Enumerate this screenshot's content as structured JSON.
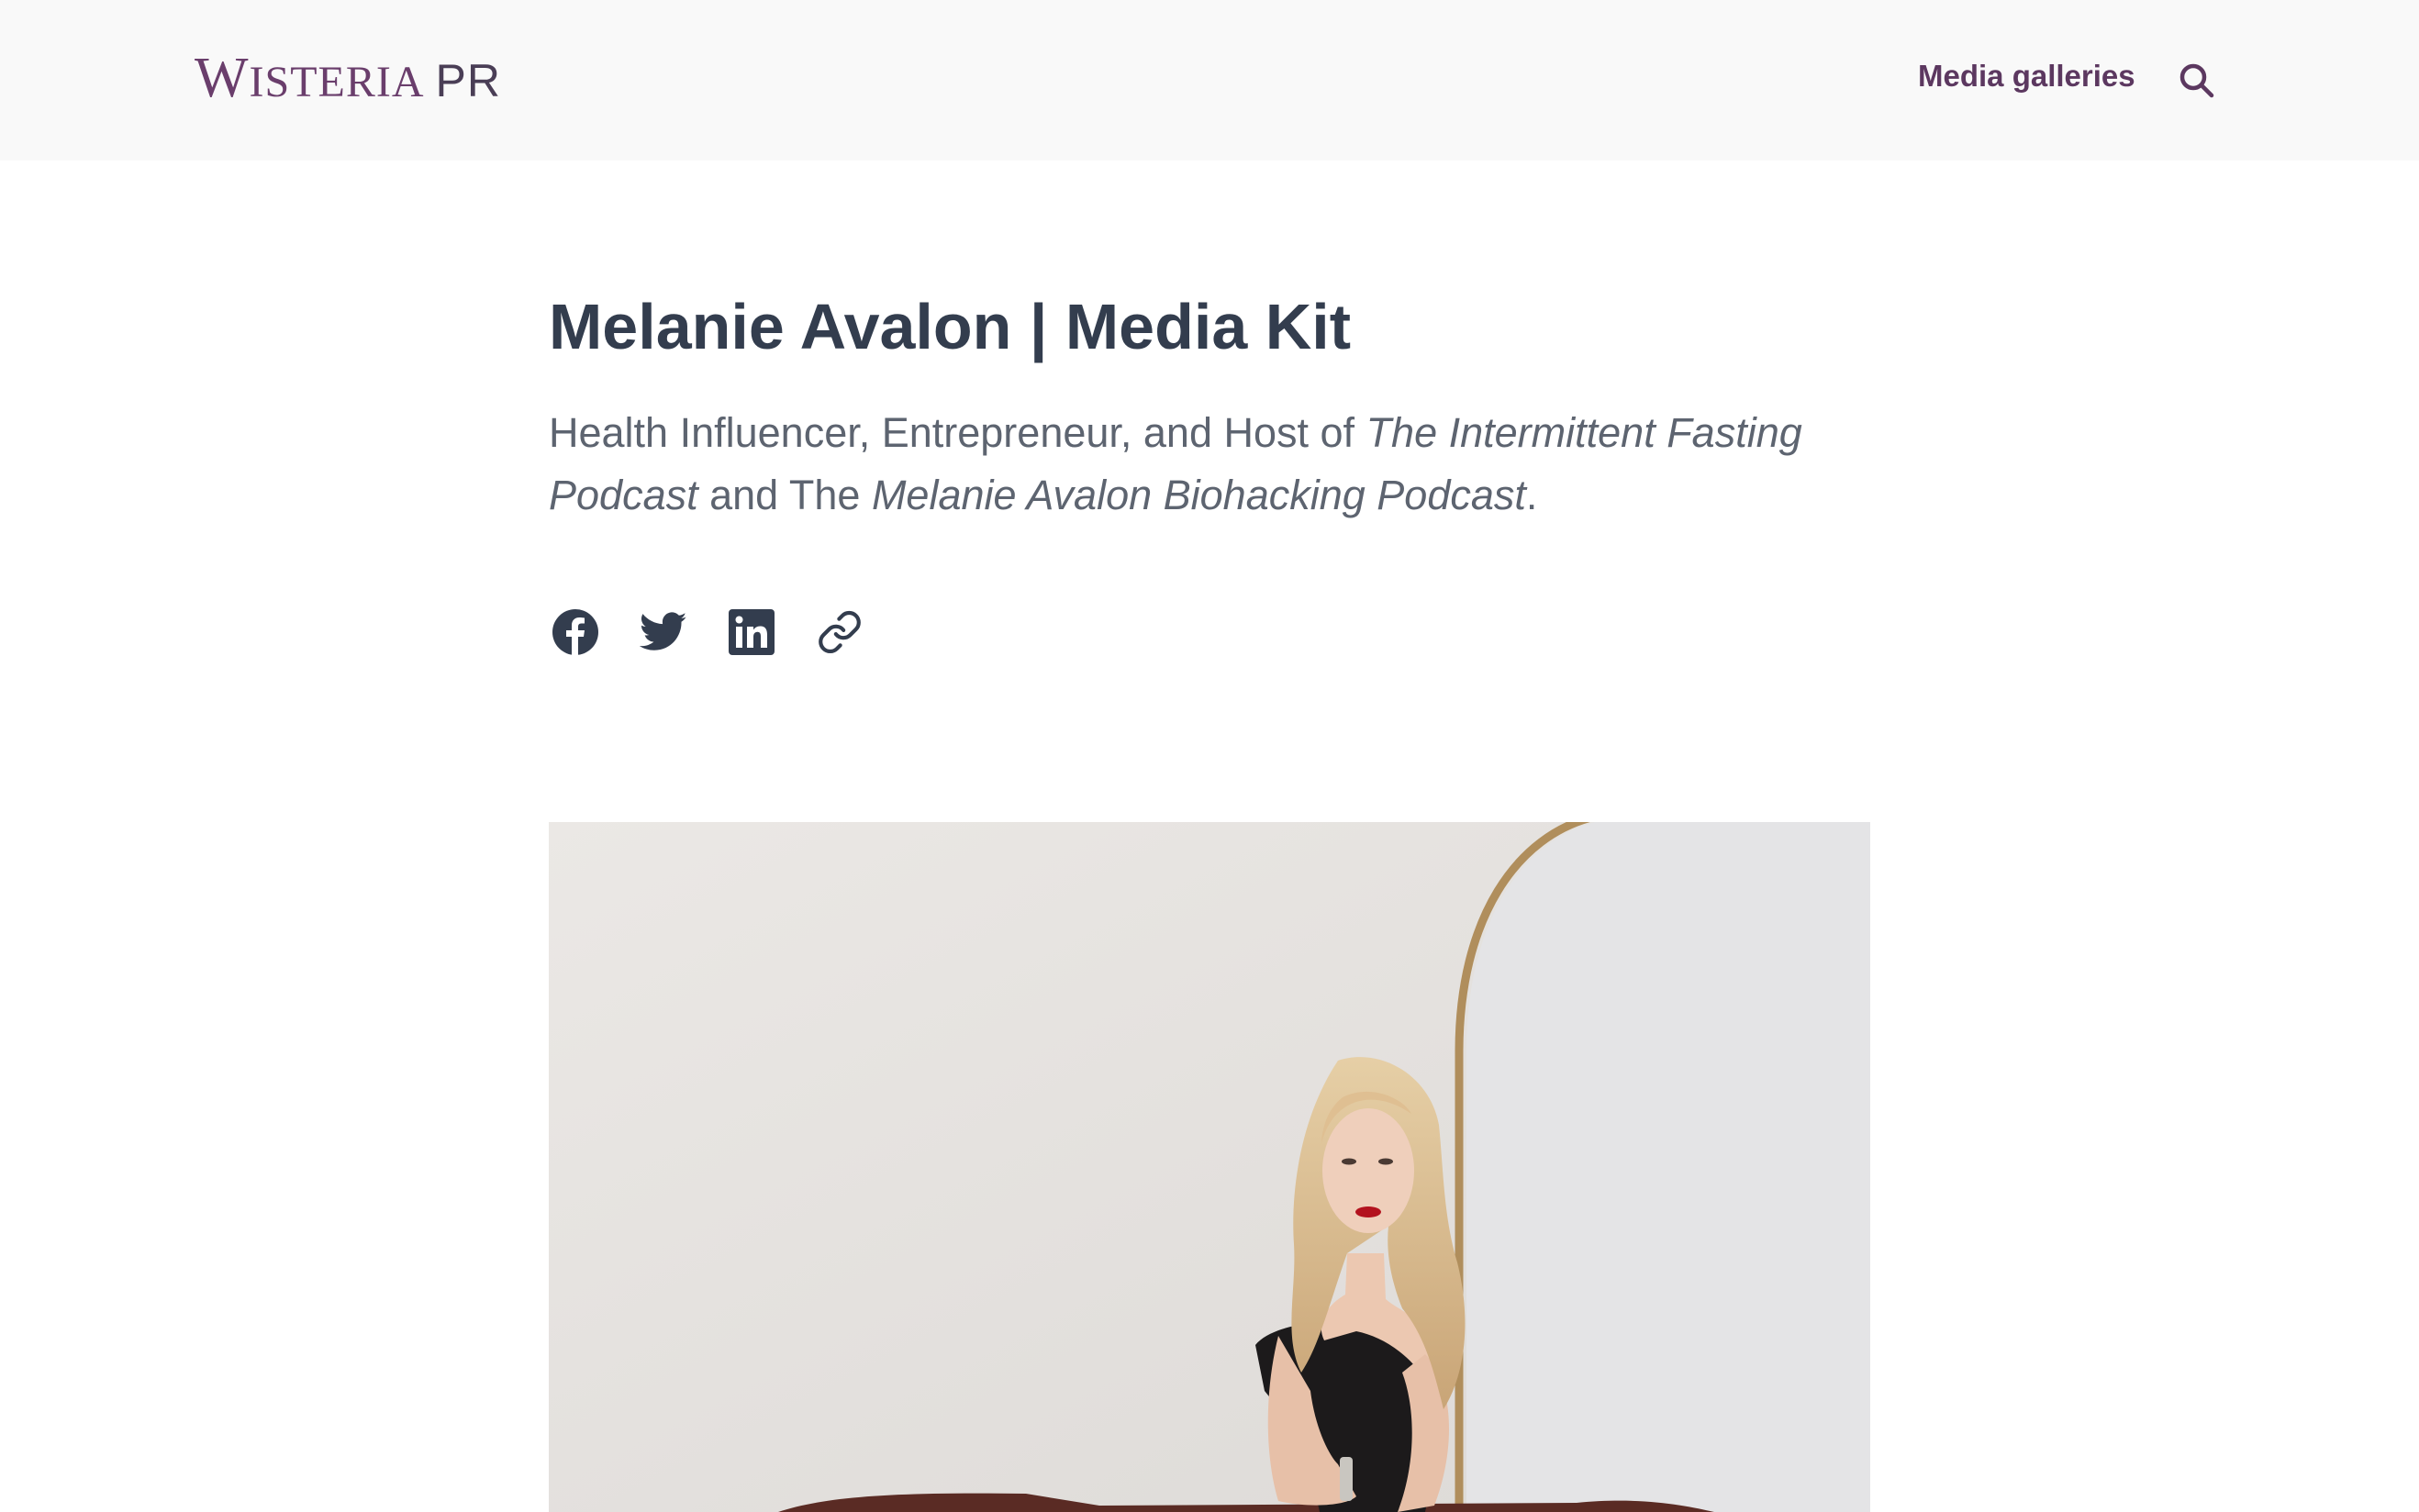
{
  "header": {
    "logo_big_letter": "W",
    "logo_rest": "ISTERIA",
    "logo_suffix": "PR",
    "nav_media_galleries": "Media galleries",
    "search_icon": "search-icon"
  },
  "main": {
    "title": "Melanie Avalon | Media Kit",
    "subtitle_part1": "Health Influencer, Entrepreneur, and Host of ",
    "subtitle_italic1": "The Intermittent Fasting Podcast",
    "subtitle_part2": " and The ",
    "subtitle_italic2": "Melanie Avalon Biohacking Podcast",
    "subtitle_part3": "."
  },
  "social": {
    "icons": [
      "facebook-icon",
      "twitter-icon",
      "linkedin-icon",
      "link-icon"
    ]
  },
  "colors": {
    "brand": "#6a3e6c",
    "heading": "#333d4e",
    "body_text": "#5d6470",
    "header_bg": "#f9f9f9"
  }
}
